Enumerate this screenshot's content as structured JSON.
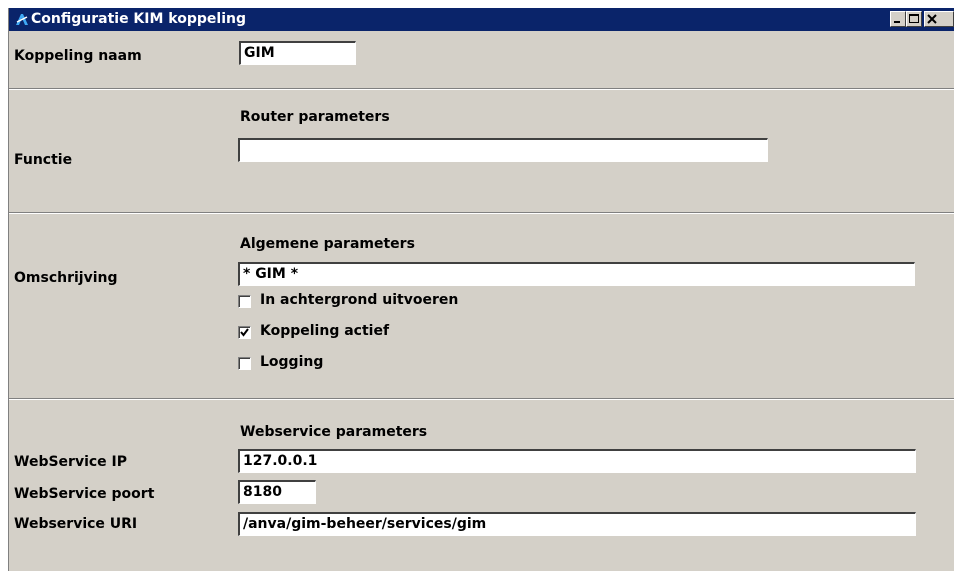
{
  "window": {
    "title": "Configuratie KIM koppeling",
    "icon": "anva-app-icon",
    "controls": [
      "minimize-icon",
      "maximize-icon",
      "close-icon"
    ]
  },
  "koppeling": {
    "name_label": "Koppeling naam",
    "name_value": "GIM"
  },
  "router": {
    "section_title": "Router parameters",
    "functie_label": "Functie",
    "functie_value": ""
  },
  "algemeen": {
    "section_title": "Algemene parameters",
    "omschrijving_label": "Omschrijving",
    "omschrijving_value": "* GIM *",
    "checkboxes": [
      {
        "label": "In achtergrond uitvoeren",
        "checked": false
      },
      {
        "label": "Koppeling actief",
        "checked": true
      },
      {
        "label": "Logging",
        "checked": false
      }
    ]
  },
  "webservice": {
    "section_title": "Webservice parameters",
    "ip_label": "WebService IP",
    "ip_value": "127.0.0.1",
    "port_label": "WebService poort",
    "port_value": "8180",
    "uri_label": "Webservice URI",
    "uri_value": "/anva/gim-beheer/services/gim"
  }
}
